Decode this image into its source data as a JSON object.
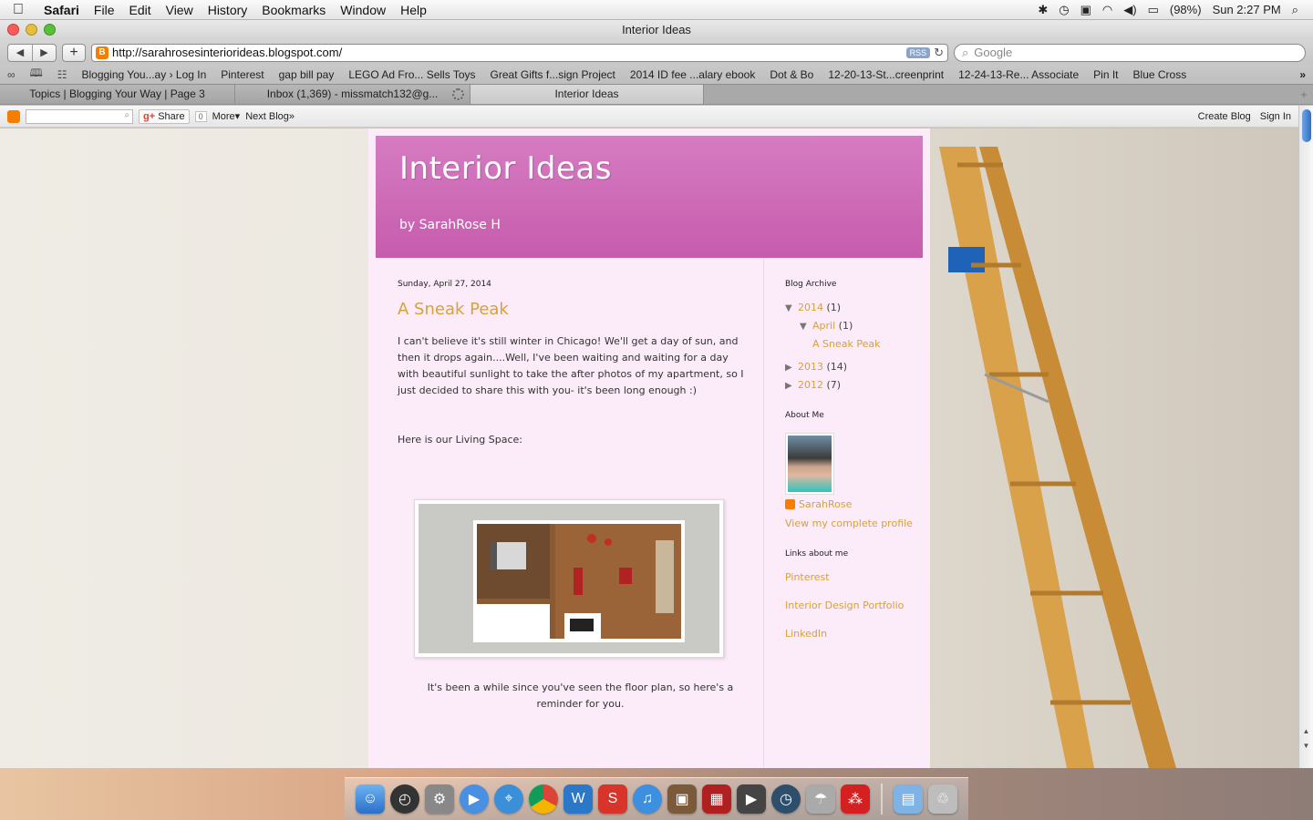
{
  "menubar": {
    "app": "Safari",
    "items": [
      "File",
      "Edit",
      "View",
      "History",
      "Bookmarks",
      "Window",
      "Help"
    ],
    "battery": "(98%)",
    "clock": "Sun 2:27 PM"
  },
  "window": {
    "title": "Interior Ideas",
    "url": "http://sarahrosesinteriorideas.blogspot.com/",
    "rss_label": "RSS",
    "search_placeholder": "Google"
  },
  "bookmarks": [
    "Blogging You...ay › Log In",
    "Pinterest",
    "gap bill pay",
    "LEGO Ad Fro... Sells Toys",
    "Great Gifts f...sign Project",
    "2014 ID fee ...alary ebook",
    "Dot & Bo",
    "12-20-13-St...creenprint",
    "12-24-13-Re... Associate",
    "Pin It",
    "Blue Cross"
  ],
  "tabs": [
    {
      "label": "Topics | Blogging Your Way | Page 3"
    },
    {
      "label": "Inbox (1,369) - missmatch132@g..."
    },
    {
      "label": "Interior Ideas"
    }
  ],
  "blogger_nav": {
    "share": "Share",
    "share_count": "0",
    "more": "More▾",
    "next_blog": "Next Blog»",
    "create_blog": "Create Blog",
    "sign_in": "Sign In"
  },
  "blog": {
    "title": "Interior Ideas",
    "subtitle": "by SarahRose H",
    "post": {
      "date": "Sunday, April 27, 2014",
      "title": "A Sneak Peak",
      "para1": "I can't believe it's still winter in Chicago!  We'll get a day of sun, and then it drops again....Well, I've been waiting and waiting for a day with beautiful sunlight to take the after photos of my apartment, so I just decided to share this with you- it's been long enough :)",
      "para2": "Here is our Living Space:",
      "caption": "It's been a while since you've seen the floor plan, so here's a reminder for you."
    },
    "sidebar": {
      "archive_title": "Blog Archive",
      "archive": [
        {
          "year": "2014",
          "count": "(1)",
          "month": "April",
          "month_count": "(1)",
          "post": "A Sneak Peak"
        },
        {
          "year": "2013",
          "count": "(14)"
        },
        {
          "year": "2012",
          "count": "(7)"
        }
      ],
      "about_title": "About Me",
      "profile_name": "SarahRose",
      "profile_link": "View my complete profile",
      "links_title": "Links about me",
      "links": [
        "Pinterest",
        "Interior Design Portfolio",
        "LinkedIn"
      ]
    }
  },
  "colors": {
    "header_pink": "#c65cac",
    "page_pink": "#fcebf8",
    "link_gold": "#d5a23c"
  }
}
